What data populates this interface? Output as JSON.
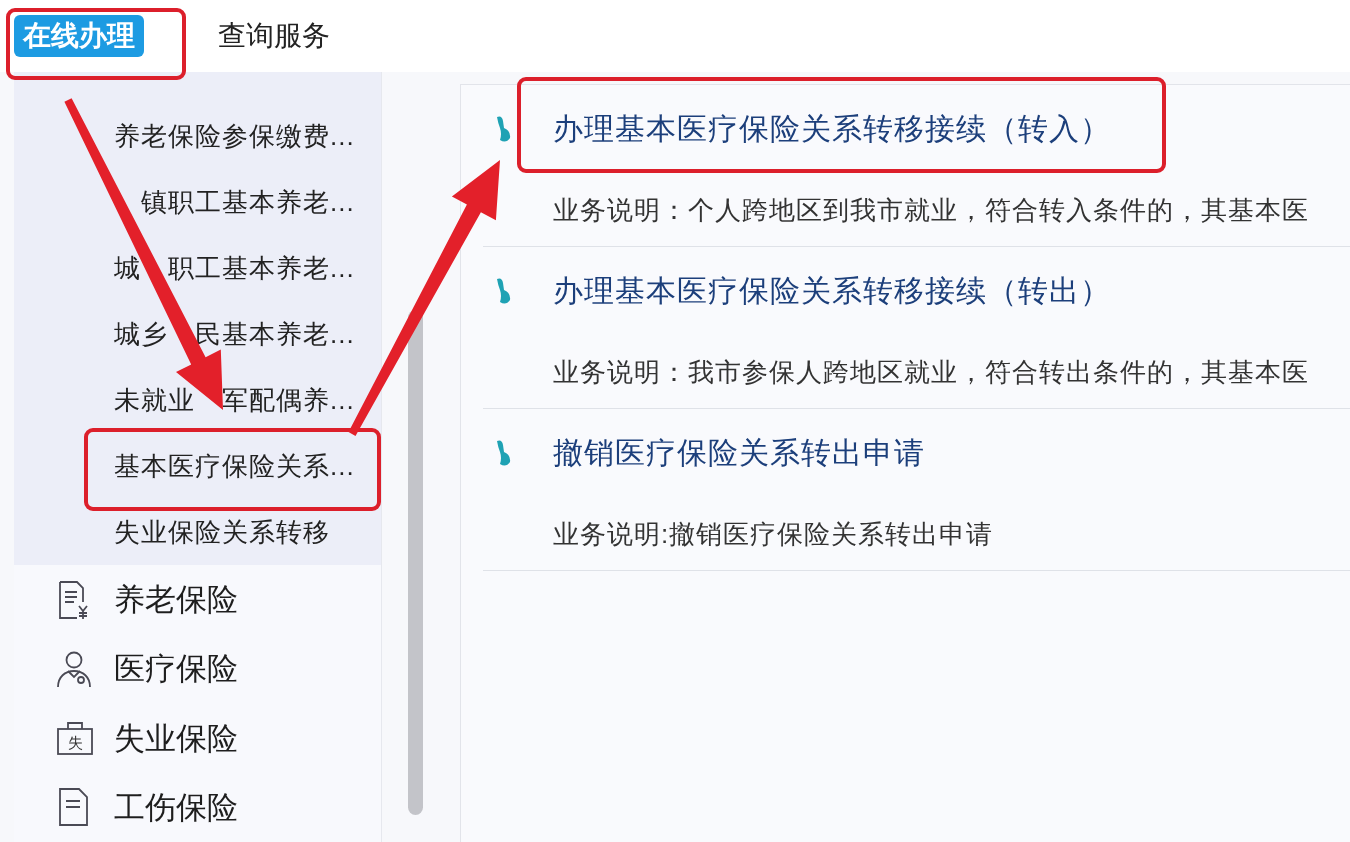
{
  "tabs": [
    {
      "label": "在线办理",
      "selected": true,
      "annotated": true
    },
    {
      "label": "查询服务",
      "selected": false,
      "annotated": false
    }
  ],
  "sidebar": {
    "submenu": [
      {
        "parts": [
          "养老保险参保缴费..."
        ],
        "annotated": false
      },
      {
        "parts": [
          "镇职工基本养老..."
        ],
        "first_char_covered": true,
        "annotated": false
      },
      {
        "parts": [
          "城",
          "职工基本养老..."
        ],
        "annotated": false
      },
      {
        "parts": [
          "城乡",
          "民基本养老..."
        ],
        "annotated": false
      },
      {
        "parts": [
          "未就业",
          "军配偶养..."
        ],
        "annotated": false
      },
      {
        "parts": [
          "基本医疗保险关系..."
        ],
        "annotated": true
      },
      {
        "parts": [
          "失业保险关系转移"
        ],
        "annotated": false
      }
    ],
    "items": [
      {
        "kind": "pension",
        "label": "养老保险"
      },
      {
        "kind": "medical",
        "label": "医疗保险"
      },
      {
        "kind": "unemployment",
        "label": "失业保险",
        "icon_text": "失"
      },
      {
        "kind": "injury",
        "label": "工伤保险"
      }
    ]
  },
  "services": [
    {
      "title": "办理基本医疗保险关系转移接续（转入）",
      "description": "业务说明：个人跨地区到我市就业，符合转入条件的，其基本医",
      "annotated": true
    },
    {
      "title": "办理基本医疗保险关系转移接续（转出）",
      "description": "业务说明：我市参保人跨地区就业，符合转出条件的，其基本医",
      "annotated": false
    },
    {
      "title": "撤销医疗保险关系转出申请",
      "description": "业务说明:撤销医疗保险关系转出申请",
      "annotated": false
    }
  ]
}
